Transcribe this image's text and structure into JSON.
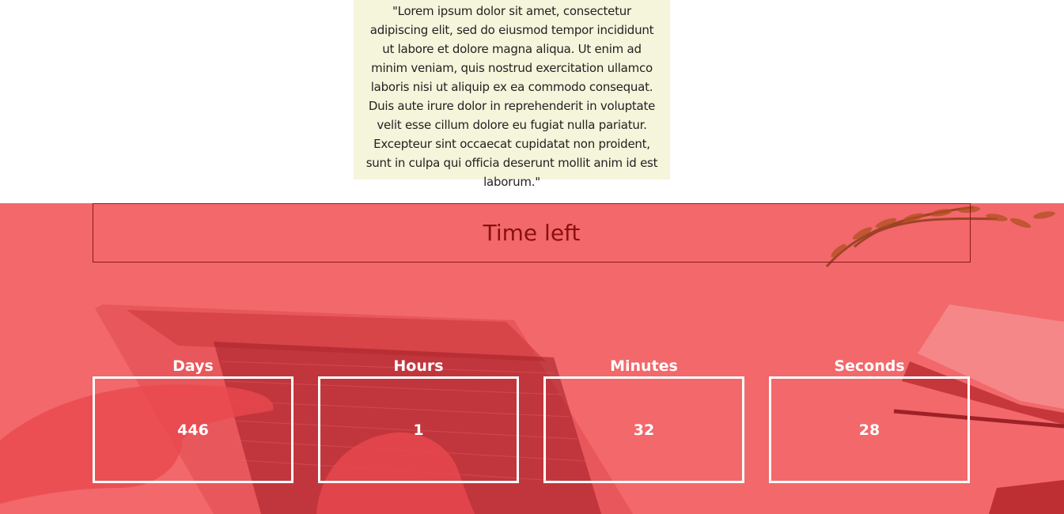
{
  "quote": {
    "text": "\"Lorem ipsum dolor sit amet, consectetur adipiscing elit, sed do eiusmod tempor incididunt ut labore et dolore magna aliqua. Ut enim ad minim veniam, quis nostrud exercitation ullamco laboris nisi ut aliquip ex ea commodo consequat. Duis aute irure dolor in reprehenderit in voluptate velit esse cillum dolore eu fugiat nulla pariatur. Excepteur sint occaecat cupidatat non proident, sunt in culpa qui officia deserunt mollit anim id est laborum.\""
  },
  "countdown": {
    "title": "Time left",
    "units": [
      {
        "label": "Days",
        "value": "446"
      },
      {
        "label": "Hours",
        "value": "1"
      },
      {
        "label": "Minutes",
        "value": "32"
      },
      {
        "label": "Seconds",
        "value": "28"
      }
    ]
  },
  "colors": {
    "quote_background": "#f5f5dc",
    "countdown_overlay": "#f2686b",
    "title_color": "#8b1010",
    "box_border": "#ffffff"
  }
}
